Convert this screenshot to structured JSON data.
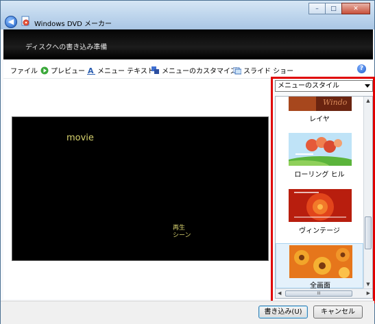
{
  "window": {
    "title": "Windows DVD メーカー",
    "caption": {
      "minimize": "–",
      "maximize": "□",
      "close": "✕"
    }
  },
  "header": {
    "text": "ディスクへの書き込み準備"
  },
  "toolbar": {
    "file": "ファイル",
    "preview": "プレビュー",
    "menu_text": "メニュー テキスト",
    "customize": "メニューのカスタマイズ",
    "slideshow": "スライド ショー",
    "help": "?"
  },
  "preview": {
    "title": "movie",
    "menu_play": "再生",
    "menu_scenes": "シーン"
  },
  "styles": {
    "dropdown_value": "メニューのスタイル",
    "items": [
      {
        "label": "レイヤ",
        "thumb_text": "Windo"
      },
      {
        "label": "ローリング ヒル"
      },
      {
        "label": "ヴィンテージ"
      },
      {
        "label": "全画面"
      }
    ],
    "hscroll_grip": "III"
  },
  "buttons": {
    "burn": "書き込み(U)",
    "cancel": "キャンセル"
  },
  "colors": {
    "highlight_border": "#e00000",
    "preview_text": "#d8d36f"
  }
}
